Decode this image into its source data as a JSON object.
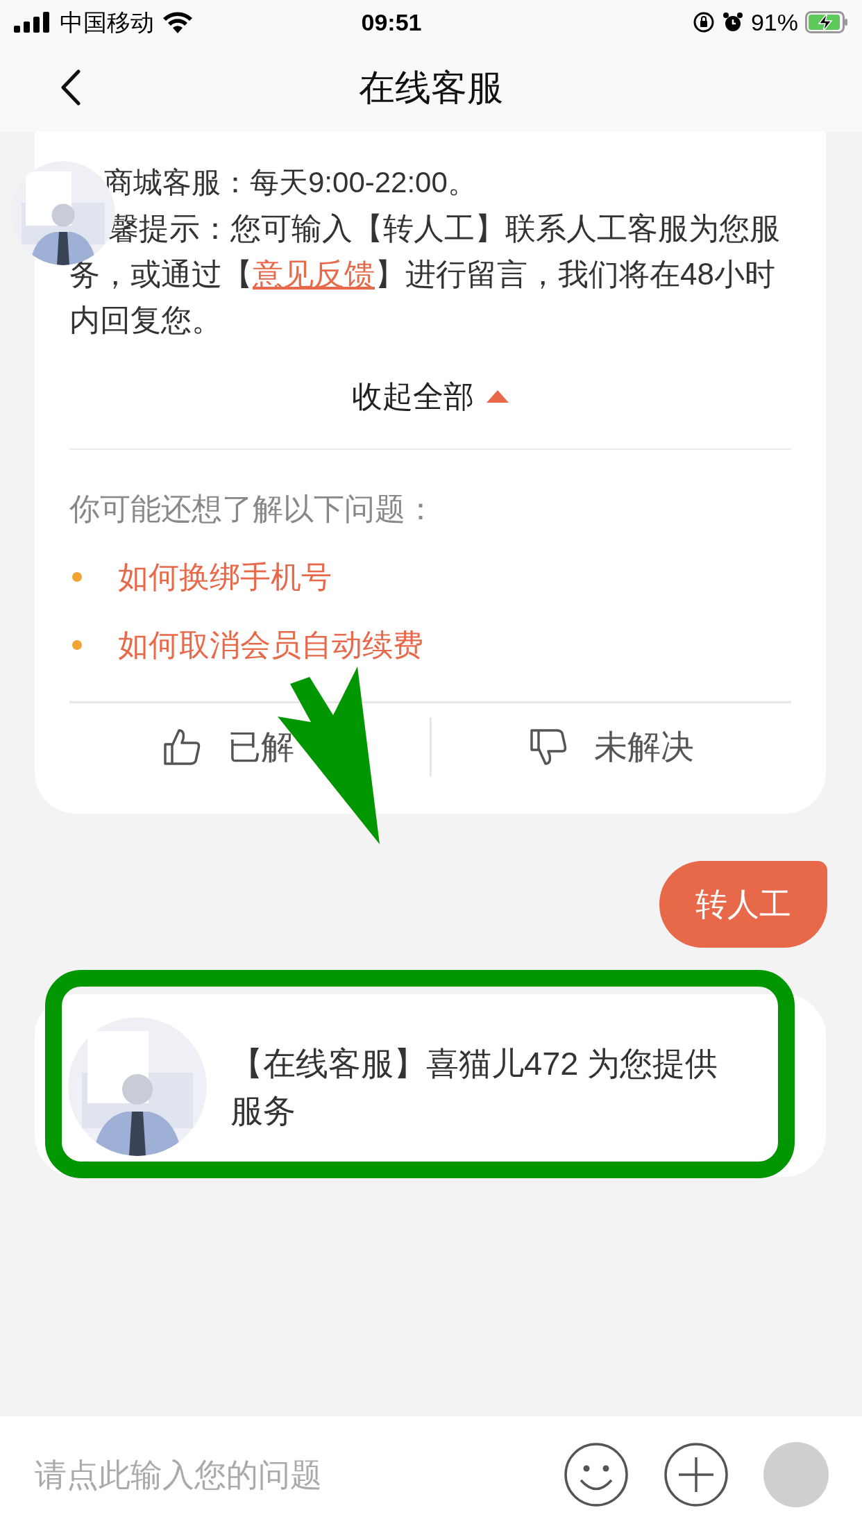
{
  "status_bar": {
    "carrier": "中国移动",
    "time": "09:51",
    "battery": "91%"
  },
  "header": {
    "title": "在线客服"
  },
  "answer_card": {
    "hours_line": "商城客服：每天9:00-22:00。",
    "tip": {
      "before": "馨提示：您可输入【转人工】联系人工客服为您服务，或通过【",
      "link": "意见反馈",
      "after": "】进行留言，我们将在48小时内回复您。"
    },
    "collapse": {
      "label": "收起全部"
    },
    "related": {
      "title": "你可能还想了解以下问题：",
      "items": [
        {
          "text": "如何换绑手机号"
        },
        {
          "text": "如何取消会员自动续费"
        }
      ]
    },
    "feedback": [
      {
        "kind": "up",
        "label": "已解"
      },
      {
        "kind": "down",
        "label": "未解决"
      }
    ]
  },
  "messages": [
    {
      "kind": "user",
      "text": "转人工"
    },
    {
      "kind": "agent",
      "text": "【在线客服】喜猫儿472 为您提供服务"
    }
  ],
  "input": {
    "placeholder": "请点此输入您的问题"
  }
}
